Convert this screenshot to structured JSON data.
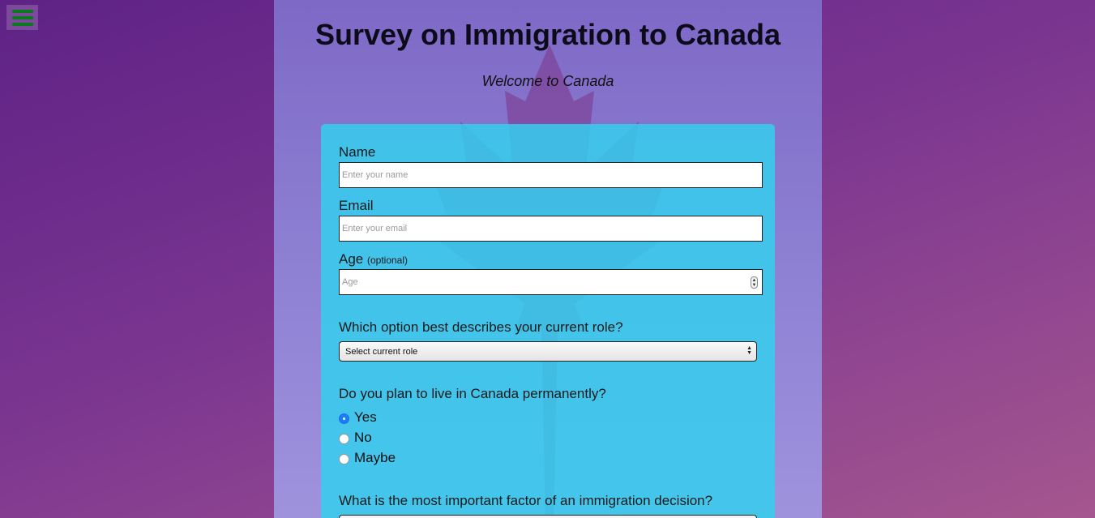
{
  "header": {
    "title": "Survey on Immigration to Canada",
    "subtitle": "Welcome to Canada"
  },
  "form": {
    "name": {
      "label": "Name",
      "placeholder": "Enter your name",
      "value": ""
    },
    "email": {
      "label": "Email",
      "placeholder": "Enter your email",
      "value": ""
    },
    "age": {
      "label": "Age",
      "optional_hint": "(optional)",
      "placeholder": "Age",
      "value": ""
    },
    "role": {
      "question": "Which option best describes your current role?",
      "selected": "Select current role"
    },
    "permanent": {
      "question": "Do you plan to live in Canada permanently?",
      "options": [
        "Yes",
        "No",
        "Maybe"
      ],
      "selected": "Yes"
    },
    "factor": {
      "question": "What is the most important factor of an immigration decision?"
    }
  },
  "colors": {
    "card": "#36ceee",
    "menu_bars": "#0b7a1c",
    "radio_selected": "#1a7ef5",
    "leaf": "#7d3a8e"
  },
  "icons": {
    "menu": "hamburger-menu-icon",
    "leaf": "maple-leaf-icon"
  }
}
